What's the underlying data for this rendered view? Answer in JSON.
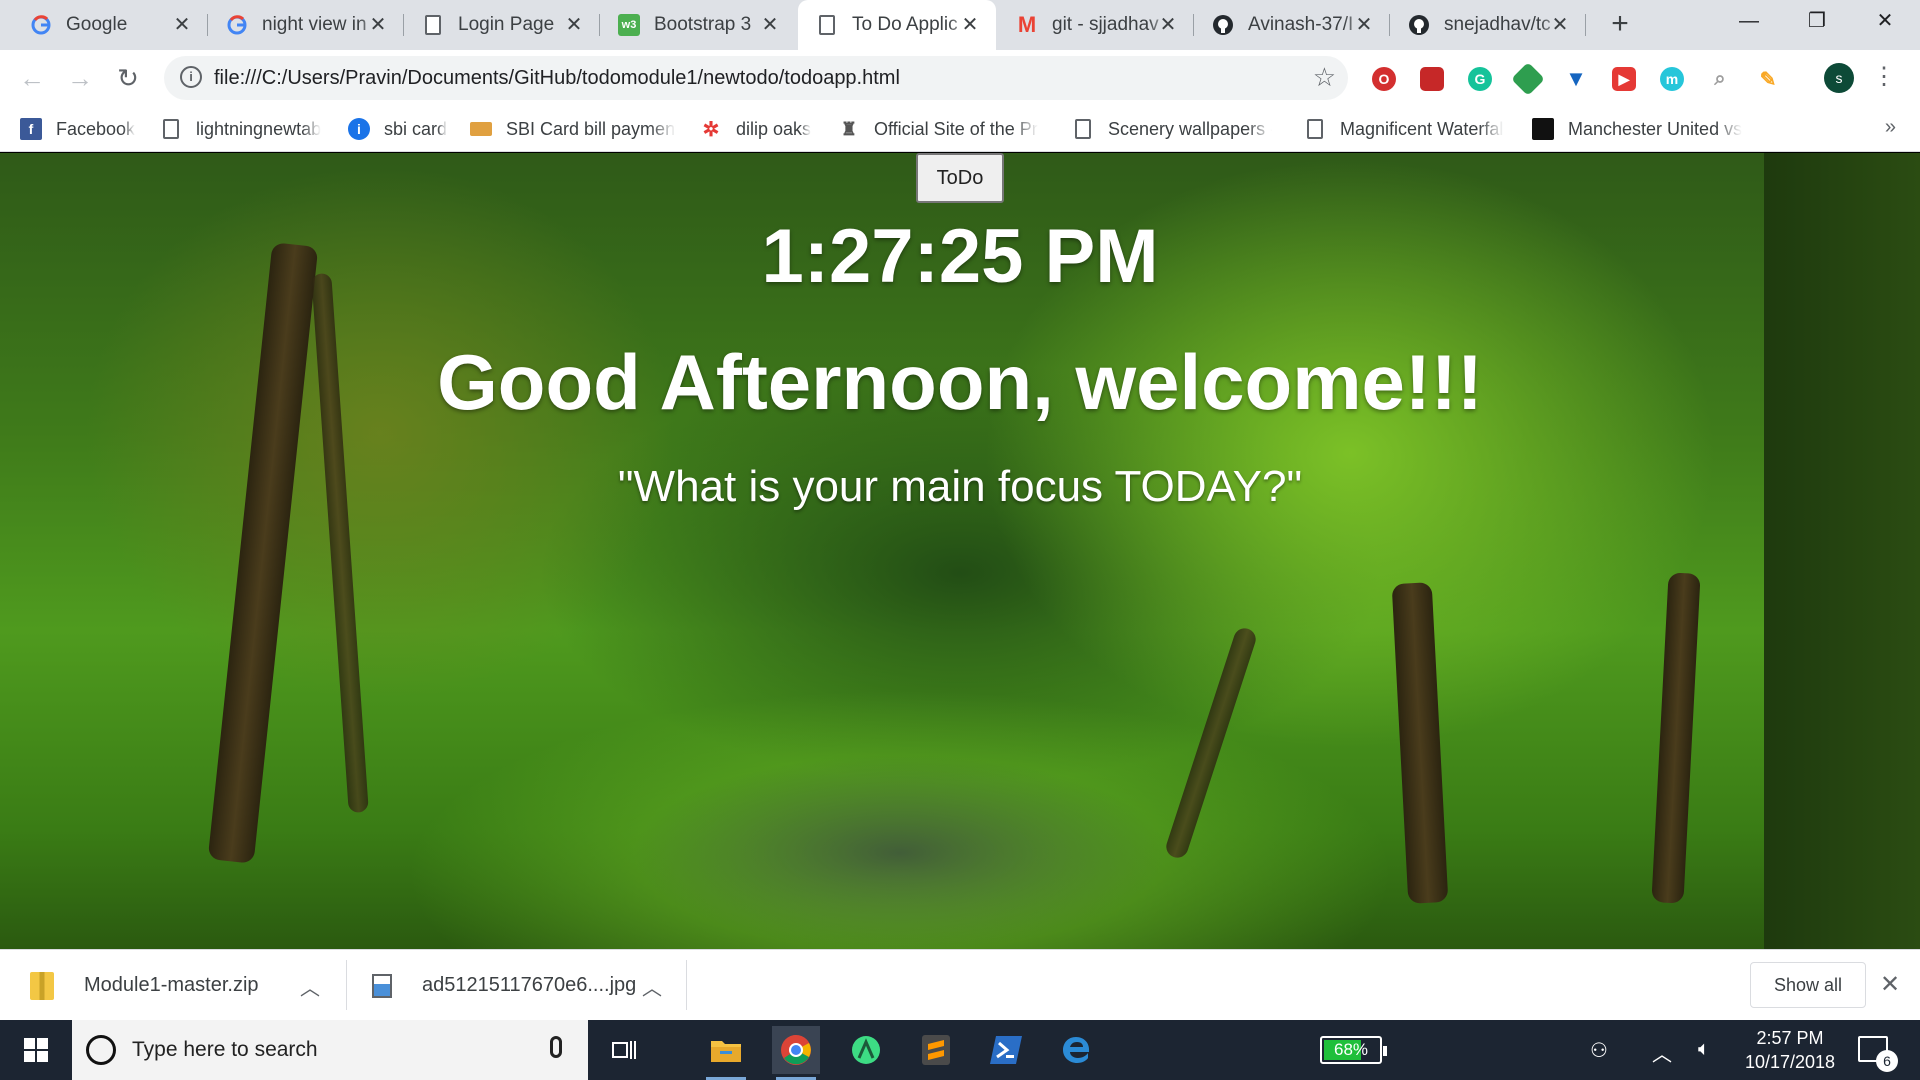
{
  "browser": {
    "tabs": [
      {
        "title": "Google",
        "icon": "google-icon",
        "active": false
      },
      {
        "title": "night view in",
        "icon": "google-icon",
        "active": false
      },
      {
        "title": "Login Page",
        "icon": "page-icon",
        "active": false
      },
      {
        "title": "Bootstrap 3",
        "icon": "w3schools-icon",
        "active": false
      },
      {
        "title": "To Do Applic",
        "icon": "page-icon",
        "active": true
      },
      {
        "title": "git - sjjadhav",
        "icon": "gmail-icon",
        "active": false
      },
      {
        "title": "Avinash-37/I",
        "icon": "github-icon",
        "active": false
      },
      {
        "title": "snejadhav/tc",
        "icon": "github-icon",
        "active": false
      }
    ],
    "new_tab_label": "+",
    "window_controls": {
      "minimize": "—",
      "maximize": "❐",
      "close": "✕"
    },
    "url": "file:///C:/Users/Pravin/Documents/GitHub/todomodule1/newtodo/todoapp.html",
    "profile_initial": "s",
    "bookmarks": [
      {
        "label": "Facebook",
        "icon": "facebook-icon"
      },
      {
        "label": "lightningnewtab",
        "icon": "page-icon"
      },
      {
        "label": "sbi card",
        "icon": "sbi-icon"
      },
      {
        "label": "SBI Card bill payment",
        "icon": "card-icon"
      },
      {
        "label": "dilip oaks",
        "icon": "flower-icon"
      },
      {
        "label": "Official Site of the Pr",
        "icon": "emblem-icon"
      },
      {
        "label": "Scenery wallpapers -",
        "icon": "page-icon"
      },
      {
        "label": "Magnificent Waterfall",
        "icon": "page-icon"
      },
      {
        "label": "Manchester United vs",
        "icon": "mu-icon"
      }
    ],
    "bookmarks_more": "»"
  },
  "page": {
    "todo_button": "ToDo",
    "clock": "1:27:25 PM",
    "greeting": "Good Afternoon, welcome!!!",
    "focus_prompt": "\"What is your main focus TODAY?\""
  },
  "downloads": {
    "items": [
      {
        "name": "Module1-master.zip",
        "icon": "zip-icon"
      },
      {
        "name": "ad51215117670e6....jpg",
        "icon": "image-icon"
      }
    ],
    "show_all": "Show all"
  },
  "taskbar": {
    "search_placeholder": "Type here to search",
    "battery_text": "68%",
    "battery_level": 0.68,
    "time": "2:57 PM",
    "date": "10/17/2018",
    "notification_count": "6"
  },
  "colors": {
    "taskbar": "#1c2532",
    "tabstrip": "#dee1e6",
    "battery": "#1fbf3a"
  }
}
